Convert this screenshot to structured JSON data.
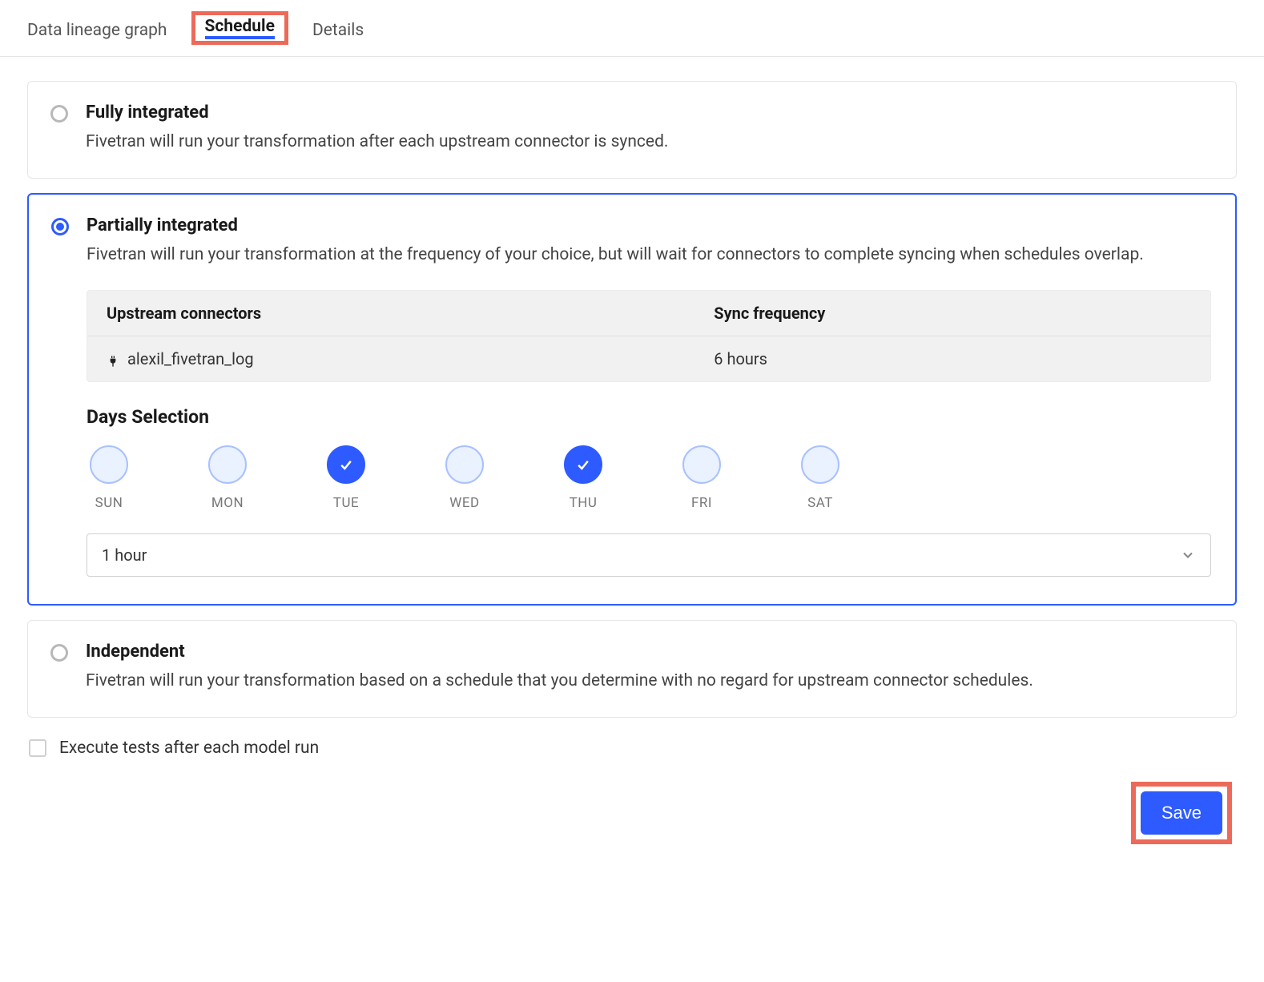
{
  "tabs": {
    "lineage": "Data lineage graph",
    "schedule": "Schedule",
    "details": "Details"
  },
  "options": {
    "fully": {
      "title": "Fully integrated",
      "desc": "Fivetran will run your transformation after each upstream connector is synced."
    },
    "partially": {
      "title": "Partially integrated",
      "desc": "Fivetran will run your transformation at the frequency of your choice, but will wait for connectors to complete syncing when schedules overlap."
    },
    "independent": {
      "title": "Independent",
      "desc": "Fivetran will run your transformation based on a schedule that you determine with no regard for upstream connector schedules."
    }
  },
  "connectors": {
    "header_name": "Upstream connectors",
    "header_freq": "Sync frequency",
    "row_name": "alexil_fivetran_log",
    "row_freq": "6 hours"
  },
  "days": {
    "heading": "Days Selection",
    "labels": [
      "SUN",
      "MON",
      "TUE",
      "WED",
      "THU",
      "FRI",
      "SAT"
    ],
    "selected": [
      false,
      false,
      true,
      false,
      true,
      false,
      false
    ]
  },
  "frequency_select": "1 hour",
  "execute_tests_label": "Execute tests after each model run",
  "save_label": "Save"
}
